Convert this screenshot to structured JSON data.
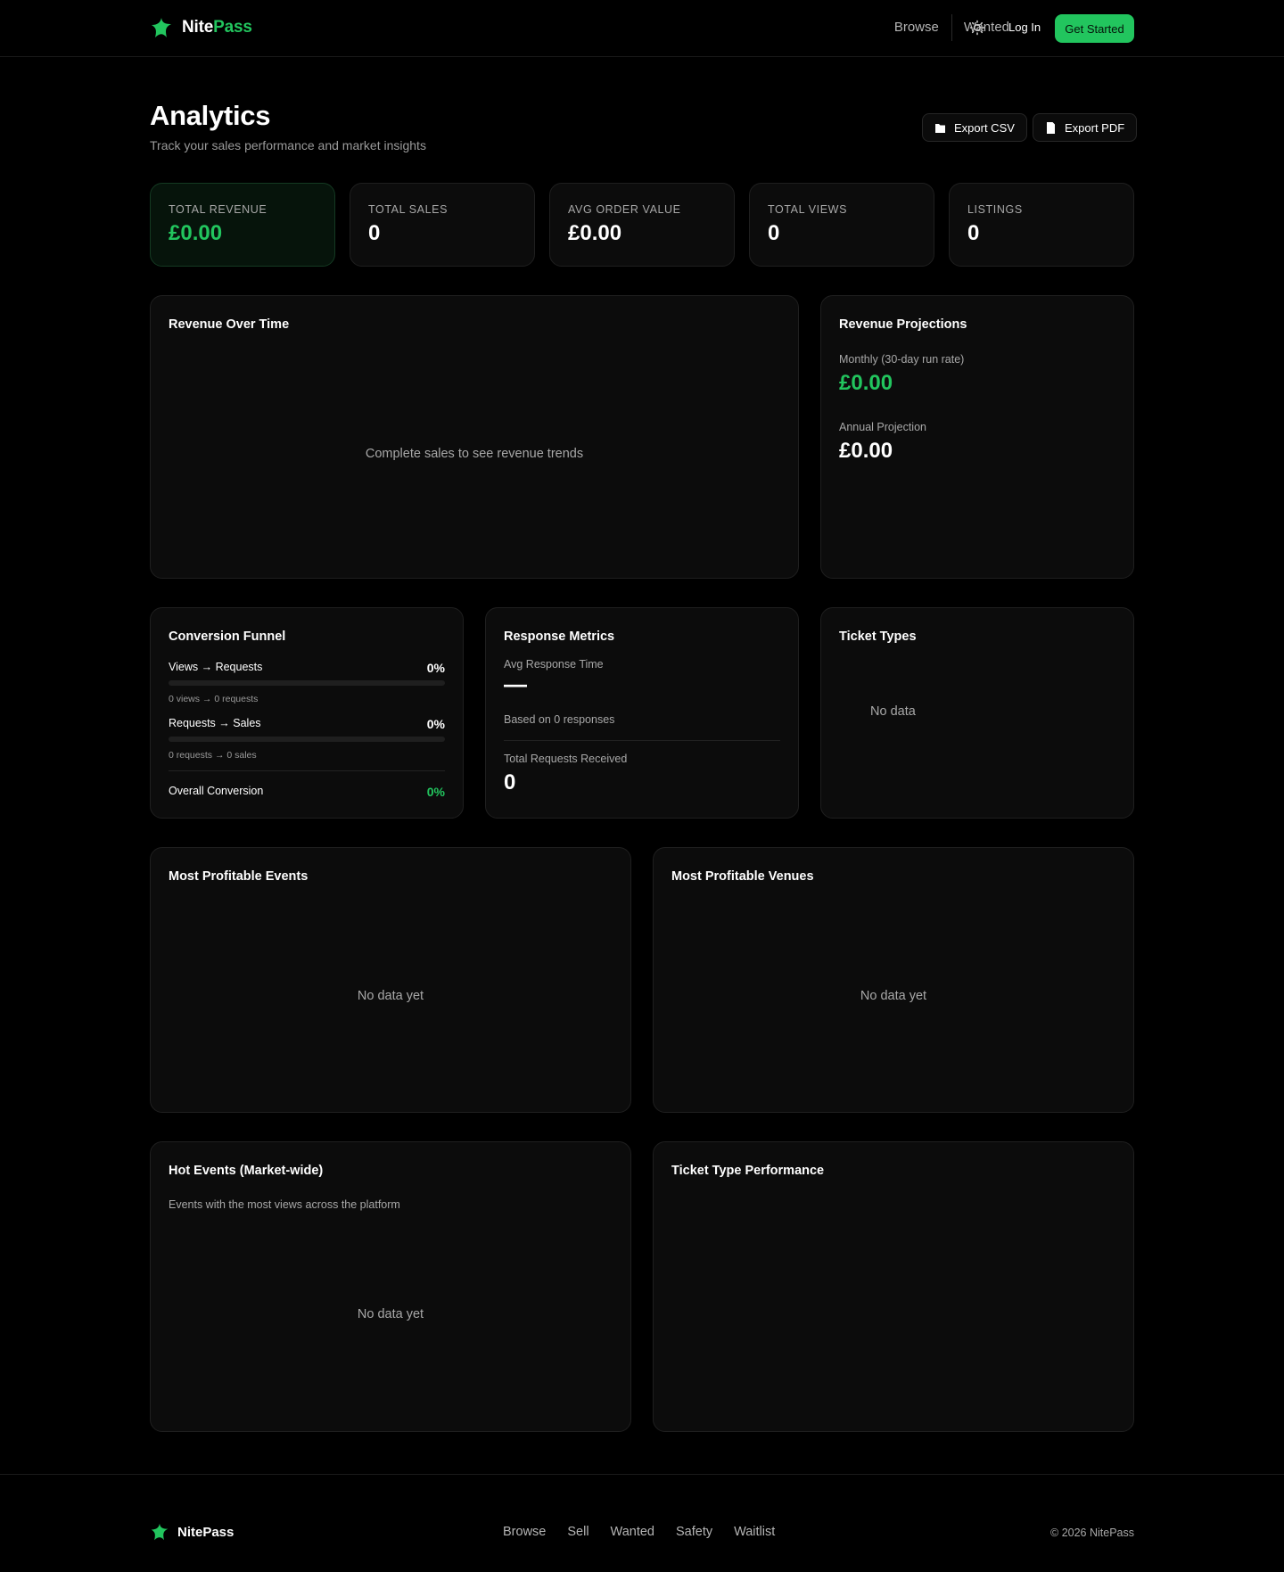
{
  "header": {
    "brand_first": "Nite",
    "brand_second": "Pass",
    "nav": [
      "Browse",
      "Wanted"
    ],
    "login": "Log In",
    "cta": "Get Started",
    "theme_icon": "sun-icon"
  },
  "page": {
    "title": "Analytics",
    "subtitle": "Track your sales performance and market insights",
    "export_csv": "Export CSV",
    "export_pdf": "Export PDF"
  },
  "stats": [
    {
      "label": "Total Revenue",
      "value": "£0.00"
    },
    {
      "label": "Total Sales",
      "value": "0"
    },
    {
      "label": "Avg Order Value",
      "value": "£0.00"
    },
    {
      "label": "Total Views",
      "value": "0"
    },
    {
      "label": "Listings",
      "value": "0"
    }
  ],
  "revenue_over_time": {
    "title": "Revenue Over Time",
    "empty": "Complete sales to see revenue trends"
  },
  "projections": {
    "title": "Revenue Projections",
    "monthly_label": "Monthly (30-day run rate)",
    "monthly_value": "£0.00",
    "annual_label": "Annual Projection",
    "annual_value": "£0.00"
  },
  "funnel": {
    "title": "Conversion Funnel",
    "rows": [
      {
        "name": "Views → Requests",
        "pct": "0%",
        "fill": 0,
        "detail": "0 views → 0 requests"
      },
      {
        "name": "Requests → Sales",
        "pct": "0%",
        "fill": 0,
        "detail": "0 requests → 0 sales"
      }
    ],
    "overall_label": "Overall Conversion",
    "overall_value": "0%"
  },
  "response": {
    "title": "Response Metrics",
    "avg_label": "Avg Response Time",
    "avg_value": "—",
    "based_on": "Based on 0 responses",
    "total_label": "Total Requests Received",
    "total_value": "0"
  },
  "ticket_types": {
    "title": "Ticket Types",
    "empty": "No data"
  },
  "profitable_events": {
    "title": "Most Profitable Events",
    "empty": "No data yet"
  },
  "profitable_venues": {
    "title": "Most Profitable Venues",
    "empty": "No data yet"
  },
  "hot_events": {
    "title": "Hot Events (Market-wide)",
    "subtitle": "Events with the most views across the platform",
    "empty": "No data yet"
  },
  "ticket_performance": {
    "title": "Ticket Type Performance"
  },
  "footer": {
    "brand": "NitePass",
    "links": [
      "Browse",
      "Sell",
      "Wanted",
      "Safety",
      "Waitlist"
    ],
    "copyright": "© 2026 NitePass"
  },
  "colors": {
    "accent": "#22c55e",
    "background": "#000000",
    "card": "#0c0c0c"
  }
}
